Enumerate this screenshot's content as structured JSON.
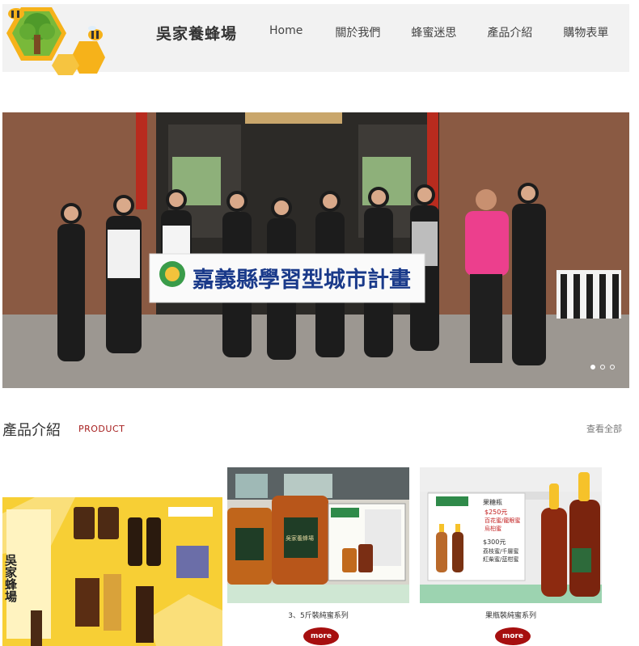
{
  "header": {
    "site_title": "吳家養蜂場",
    "nav": [
      "Home",
      "關於我們",
      "蜂蜜迷思",
      "產品介紹",
      "購物表單"
    ]
  },
  "banner": {
    "sign_text": "嘉義縣學習型城市計畫",
    "active_slide": 1,
    "slide_count": 3
  },
  "products": {
    "title": "產品介紹",
    "title_en": "PRODUCT",
    "view_all": "查看全部",
    "items": [
      {
        "caption": "",
        "more": ""
      },
      {
        "caption": "3、5斤裝純蜜系列",
        "more": "more"
      },
      {
        "caption": "果瓶裝純蜜系列",
        "more": "more"
      }
    ],
    "poster_brand": "吳家蜂場",
    "jar_label": "吳家養蜂場",
    "price_sign_title": "果糖瓶",
    "price_sign_250": "$250元",
    "price_sign_line1": "百花蜜/龍眼蜜",
    "price_sign_line2": "烏桕蜜",
    "price_sign_300": "$300元",
    "price_sign_line3": "荔枝蜜/千層蜜",
    "price_sign_line4": "紅柴蜜/蓝柑蜜"
  },
  "colors": {
    "accent": "#a60f0f",
    "header_bg": "#f2f2f2",
    "honey": "#f4b400"
  }
}
